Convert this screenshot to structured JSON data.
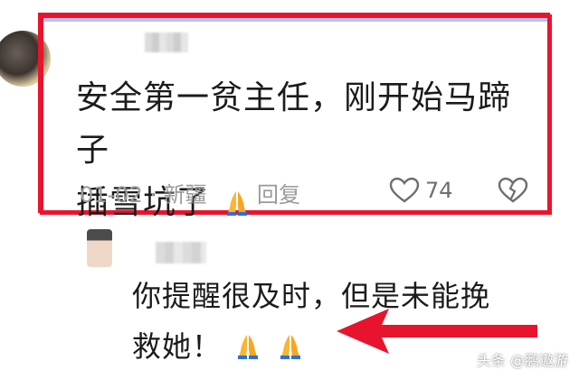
{
  "comment": {
    "text_line1": "安全第一贫主任，刚开始马蹄子",
    "text_line2": "插雪坑了",
    "date_location": "01-02 · 新疆",
    "reply_label": "回复",
    "like_count": "74"
  },
  "reply": {
    "text_line1": "你提醒很及时，但是未能挽",
    "text_line2": "救她！"
  },
  "watermark": "头条 @鹏遨游",
  "colors": {
    "highlight_border": "#e8142d",
    "arrow": "#e8142d",
    "meta_text": "#9a9a9a"
  },
  "icons": [
    "praying-hands-icon",
    "heart-icon",
    "broken-heart-icon",
    "red-arrow-icon"
  ]
}
